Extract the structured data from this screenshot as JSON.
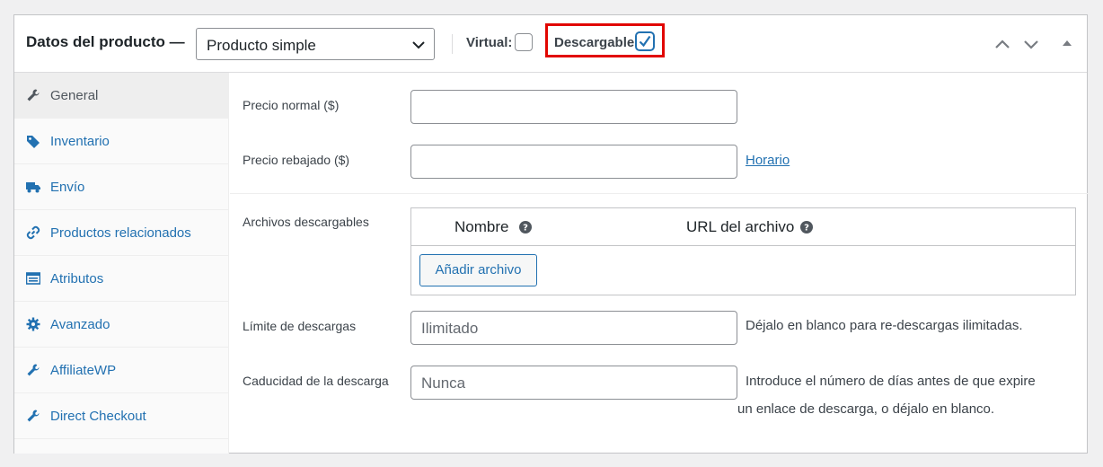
{
  "header": {
    "title": "Datos del producto —",
    "product_type": "Producto simple",
    "virtual_label": "Virtual:",
    "virtual_checked": false,
    "downloadable_label": "Descargable:",
    "downloadable_checked": true
  },
  "sidebar": {
    "items": [
      {
        "label": "General",
        "icon": "wrench-icon",
        "active": true
      },
      {
        "label": "Inventario",
        "icon": "tag-icon",
        "active": false
      },
      {
        "label": "Envío",
        "icon": "truck-icon",
        "active": false
      },
      {
        "label": "Productos relacionados",
        "icon": "link-icon",
        "active": false
      },
      {
        "label": "Atributos",
        "icon": "list-icon",
        "active": false
      },
      {
        "label": "Avanzado",
        "icon": "gear-icon",
        "active": false
      },
      {
        "label": "AffiliateWP",
        "icon": "wrench-icon",
        "active": false
      },
      {
        "label": "Direct Checkout",
        "icon": "wrench-icon",
        "active": false
      }
    ]
  },
  "general": {
    "regular_price_label": "Precio normal ($)",
    "regular_price_value": "",
    "sale_price_label": "Precio rebajado ($)",
    "sale_price_value": "",
    "schedule_link": "Horario",
    "files_label": "Archivos descargables",
    "files_col_name": "Nombre",
    "files_col_url": "URL del archivo",
    "add_file_button": "Añadir archivo",
    "limit_label": "Límite de descargas",
    "limit_placeholder": "Ilimitado",
    "limit_desc": "Déjalo en blanco para re-descargas ilimitadas.",
    "expiry_label": "Caducidad de la descarga",
    "expiry_placeholder": "Nunca",
    "expiry_desc_line1": "Introduce el número de días antes de que expire",
    "expiry_desc_line2": "un enlace de descarga, o déjalo en blanco."
  },
  "colors": {
    "accent": "#2271b1",
    "highlight": "#e10600"
  }
}
